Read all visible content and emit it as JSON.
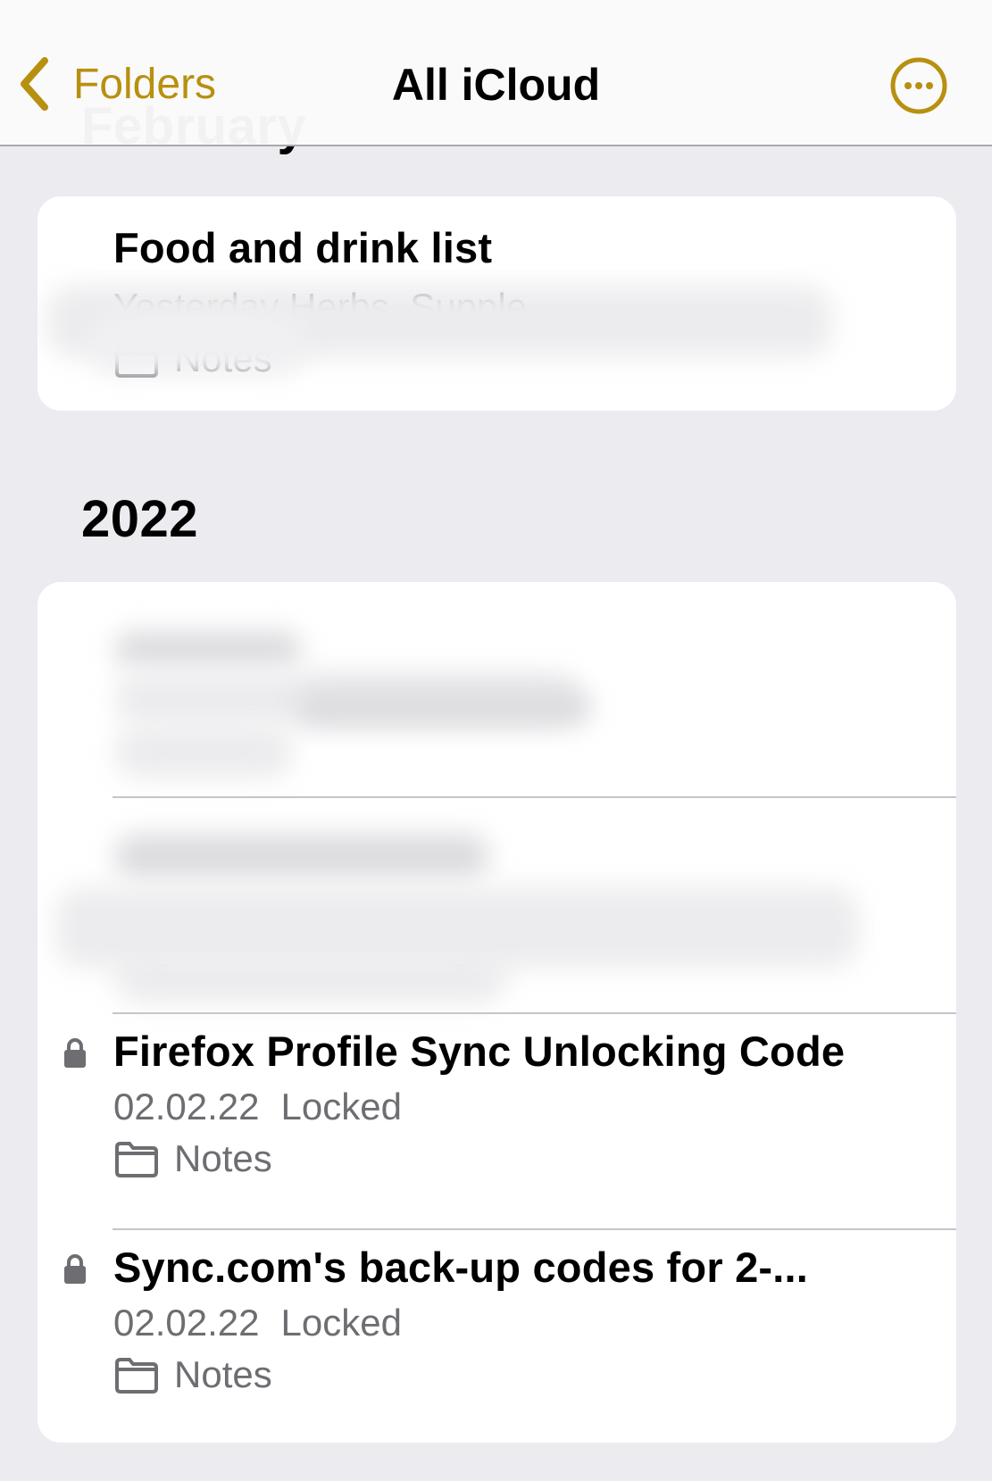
{
  "nav": {
    "back_label": "Folders",
    "title": "All iCloud",
    "more_icon": "ellipsis-circle-icon",
    "accent_color": "#b8900f"
  },
  "sections": [
    {
      "title": "February",
      "notes": [
        {
          "title": "Food and drink list",
          "meta": "Yesterday  Herbs, Supplements ... Oils (partially blurred)",
          "folder": "Notes",
          "locked": false
        }
      ]
    },
    {
      "title": "2022",
      "notes": [
        {
          "title": "",
          "redacted": true,
          "locked": false
        },
        {
          "title": "",
          "redacted": true,
          "locked": false
        },
        {
          "title": "Firefox Profile Sync Unlocking Code",
          "date": "02.02.22",
          "status": "Locked",
          "folder": "Notes",
          "locked": true
        },
        {
          "title": "Sync.com's back-up codes for 2-...",
          "date": "02.02.22",
          "status": "Locked",
          "folder": "Notes",
          "locked": true
        }
      ]
    }
  ]
}
